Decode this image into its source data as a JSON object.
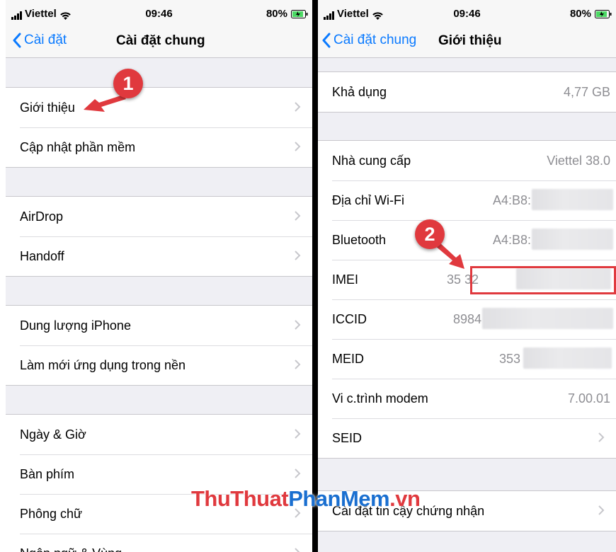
{
  "status": {
    "carrier": "Viettel",
    "time": "09:46",
    "battery": "80%"
  },
  "left": {
    "back_label": "Cài đặt",
    "title": "Cài đặt chung",
    "group1": [
      {
        "label": "Giới thiệu"
      },
      {
        "label": "Cập nhật phần mềm"
      }
    ],
    "group2": [
      {
        "label": "AirDrop"
      },
      {
        "label": "Handoff"
      }
    ],
    "group3": [
      {
        "label": "Dung lượng iPhone"
      },
      {
        "label": "Làm mới ứng dụng trong nền"
      }
    ],
    "group4": [
      {
        "label": "Ngày & Giờ"
      },
      {
        "label": "Bàn phím"
      },
      {
        "label": "Phông chữ"
      },
      {
        "label": "Ngôn ngữ & Vùng"
      }
    ]
  },
  "right": {
    "back_label": "Cài đặt chung",
    "title": "Giới thiệu",
    "group1": [
      {
        "label": "Khả dụng",
        "value": "4,77 GB"
      }
    ],
    "group2": [
      {
        "label": "Nhà cung cấp",
        "value": "Viettel 38.0"
      },
      {
        "label": "Địa chỉ Wi-Fi",
        "value": "A4:B8:"
      },
      {
        "label": "Bluetooth",
        "value": "A4:B8:"
      },
      {
        "label": "IMEI",
        "value": "35 32"
      },
      {
        "label": "ICCID",
        "value": "8984"
      },
      {
        "label": "MEID",
        "value": "353"
      },
      {
        "label": "Vi c.trình modem",
        "value": "7.00.01"
      },
      {
        "label": "SEID"
      }
    ],
    "group3": [
      {
        "label": "Cài đặt tin cậy chứng nhận"
      }
    ]
  },
  "annotations": {
    "badge1": "1",
    "badge2": "2",
    "arrow_color": "#e0393e"
  },
  "watermark": {
    "part1": "ThuThuat",
    "part2": "PhanMem",
    "part3": ".vn"
  },
  "icons": [
    "chevron-left-icon",
    "chevron-right-icon",
    "signal-icon",
    "wifi-icon",
    "battery-icon",
    "arrow-icon"
  ]
}
